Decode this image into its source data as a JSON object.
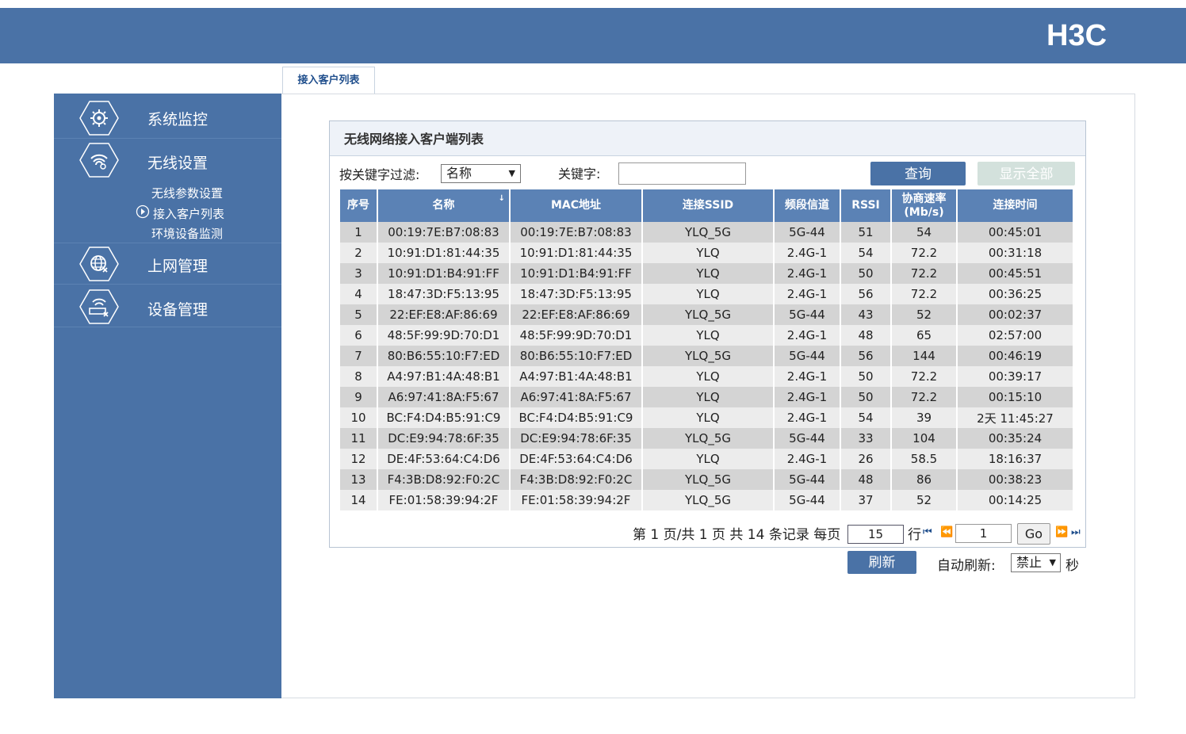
{
  "brand": {
    "logo_text": "H3C"
  },
  "sidebar": {
    "items": [
      {
        "label": "系统监控",
        "icon": "system-monitor-icon"
      },
      {
        "label": "无线设置",
        "icon": "wireless-icon"
      },
      {
        "label": "上网管理",
        "icon": "internet-icon"
      },
      {
        "label": "设备管理",
        "icon": "device-icon"
      }
    ],
    "subitems": [
      {
        "label": "无线参数设置"
      },
      {
        "label": "接入客户列表"
      },
      {
        "label": "环境设备监测"
      }
    ]
  },
  "tab": {
    "label": "接入客户列表"
  },
  "panel": {
    "title": "无线网络接入客户端列表"
  },
  "filter": {
    "label": "按关键字过滤:",
    "select_value": "名称",
    "keyword_label": "关键字:",
    "keyword_value": "",
    "query_label": "查询",
    "show_all_label": "显示全部"
  },
  "table": {
    "headers": [
      "序号",
      "名称",
      "MAC地址",
      "连接SSID",
      "频段信道",
      "RSSI",
      "协商速率 (Mb/s)",
      "连接时间"
    ],
    "rows": [
      [
        "1",
        "00:19:7E:B7:08:83",
        "00:19:7E:B7:08:83",
        "YLQ_5G",
        "5G-44",
        "51",
        "54",
        "00:45:01"
      ],
      [
        "2",
        "10:91:D1:81:44:35",
        "10:91:D1:81:44:35",
        "YLQ",
        "2.4G-1",
        "54",
        "72.2",
        "00:31:18"
      ],
      [
        "3",
        "10:91:D1:B4:91:FF",
        "10:91:D1:B4:91:FF",
        "YLQ",
        "2.4G-1",
        "50",
        "72.2",
        "00:45:51"
      ],
      [
        "4",
        "18:47:3D:F5:13:95",
        "18:47:3D:F5:13:95",
        "YLQ",
        "2.4G-1",
        "56",
        "72.2",
        "00:36:25"
      ],
      [
        "5",
        "22:EF:E8:AF:86:69",
        "22:EF:E8:AF:86:69",
        "YLQ_5G",
        "5G-44",
        "43",
        "52",
        "00:02:37"
      ],
      [
        "6",
        "48:5F:99:9D:70:D1",
        "48:5F:99:9D:70:D1",
        "YLQ",
        "2.4G-1",
        "48",
        "65",
        "02:57:00"
      ],
      [
        "7",
        "80:B6:55:10:F7:ED",
        "80:B6:55:10:F7:ED",
        "YLQ_5G",
        "5G-44",
        "56",
        "144",
        "00:46:19"
      ],
      [
        "8",
        "A4:97:B1:4A:48:B1",
        "A4:97:B1:4A:48:B1",
        "YLQ",
        "2.4G-1",
        "50",
        "72.2",
        "00:39:17"
      ],
      [
        "9",
        "A6:97:41:8A:F5:67",
        "A6:97:41:8A:F5:67",
        "YLQ",
        "2.4G-1",
        "50",
        "72.2",
        "00:15:10"
      ],
      [
        "10",
        "BC:F4:D4:B5:91:C9",
        "BC:F4:D4:B5:91:C9",
        "YLQ",
        "2.4G-1",
        "54",
        "39",
        "2天 11:45:27"
      ],
      [
        "11",
        "DC:E9:94:78:6F:35",
        "DC:E9:94:78:6F:35",
        "YLQ_5G",
        "5G-44",
        "33",
        "104",
        "00:35:24"
      ],
      [
        "12",
        "DE:4F:53:64:C4:D6",
        "DE:4F:53:64:C4:D6",
        "YLQ",
        "2.4G-1",
        "26",
        "58.5",
        "18:16:37"
      ],
      [
        "13",
        "F4:3B:D8:92:F0:2C",
        "F4:3B:D8:92:F0:2C",
        "YLQ_5G",
        "5G-44",
        "48",
        "86",
        "00:38:23"
      ],
      [
        "14",
        "FE:01:58:39:94:2F",
        "FE:01:58:39:94:2F",
        "YLQ_5G",
        "5G-44",
        "37",
        "52",
        "00:14:25"
      ]
    ]
  },
  "pager": {
    "summary": "第 1 页/共 1 页 共 14 条记录 每页",
    "per_page": "15",
    "rows_label": "行",
    "page_value": "1",
    "go_label": "Go"
  },
  "refresh": {
    "button_label": "刷新",
    "auto_label": "自动刷新:",
    "auto_value": "禁止",
    "unit": "秒"
  },
  "colors": {
    "primary": "#4a72a6",
    "header": "#5b82b5",
    "row_odd": "#d4d4d4",
    "row_even": "#ececec"
  }
}
